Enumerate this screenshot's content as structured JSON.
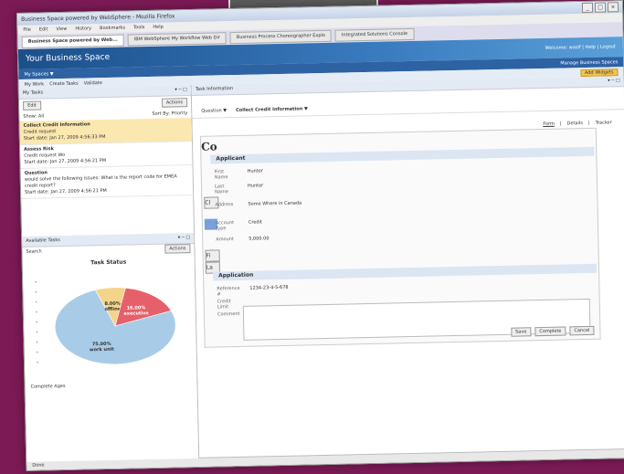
{
  "window": {
    "title": "Business Space powered by WebSphere - Mozilla Firefox"
  },
  "menu": [
    "File",
    "Edit",
    "View",
    "History",
    "Bookmarks",
    "Tools",
    "Help"
  ],
  "tabs": [
    {
      "label": "Business Space powered by Web...",
      "active": true
    },
    {
      "label": "IBM WebSphere My Workflow Web Dir",
      "active": false
    },
    {
      "label": "Business Process Choreographer Explo",
      "active": false
    },
    {
      "label": "Integrated Solutions Console",
      "active": false
    }
  ],
  "header": {
    "brand": "Your Business Space",
    "links": "Welcome: wasif | Help | Logout"
  },
  "subbar": {
    "left": "My Spaces ▼",
    "right": "Manage Business Spaces"
  },
  "toolbar": {
    "page": "My Work",
    "tabs": "Create Tasks",
    "extra": "Validate",
    "add": "Add Widgets"
  },
  "my_tasks": {
    "title": "My Tasks",
    "edit": "Edit",
    "actions": "Actions",
    "show_label": "Show: All",
    "sort_label": "Sort By: Priority",
    "items": [
      {
        "title": "Collect Credit Information",
        "l1": "Credit request",
        "l2": "Start date: Jan 27, 2009 4:56:33 PM"
      },
      {
        "title": "Assess Risk",
        "l1": "Credit request Wo",
        "l2": "Start date: Jan 27, 2009 4:56:21 PM"
      },
      {
        "title": "Question",
        "l1": "",
        "l2": "would solve the following issues: What is the report code for EMEA credit report?",
        "l3": "Start date: Jan 27, 2009 4:56:21 PM"
      }
    ]
  },
  "available_tasks": {
    "title": "Available Tasks",
    "search": "Search",
    "actions": "Actions"
  },
  "chart_data": {
    "type": "pie",
    "title": "Task Status",
    "labels": [
      "work unit",
      "offline",
      "executive"
    ],
    "values": [
      75.0,
      8.0,
      16.0
    ],
    "colors": [
      "#a8cce8",
      "#f3d48a",
      "#e5606a"
    ],
    "annotations": [
      "75.00% work unit",
      "8.00% offline",
      "16.00% executive"
    ],
    "footer": "Complete Ages"
  },
  "task_info": {
    "title": "Task Information",
    "crumbs": [
      "Question ▼",
      "Collect Credit Information ▼"
    ],
    "view_links": [
      "Form",
      "Details",
      "Tracker"
    ],
    "form_title": "Co",
    "applicant_header": "Applicant",
    "applicant_fields": [
      {
        "label": "First Name",
        "value": "Hunter"
      },
      {
        "label": "Last Name",
        "value": "Hunter"
      },
      {
        "label": "Address",
        "value": "Some Where in Canada"
      },
      {
        "label": "Account Type",
        "value": "Credit"
      },
      {
        "label": "Amount",
        "value": "5,000.00"
      }
    ],
    "application_header": "Application",
    "application_fields": [
      {
        "label": "Reference #",
        "value": "1234-23-4-5-678"
      },
      {
        "label": "Credit Limit",
        "value": ""
      },
      {
        "label": "Comment",
        "value": ""
      }
    ],
    "buttons": [
      "Save",
      "Complete",
      "Cancel"
    ]
  },
  "status": "Done"
}
